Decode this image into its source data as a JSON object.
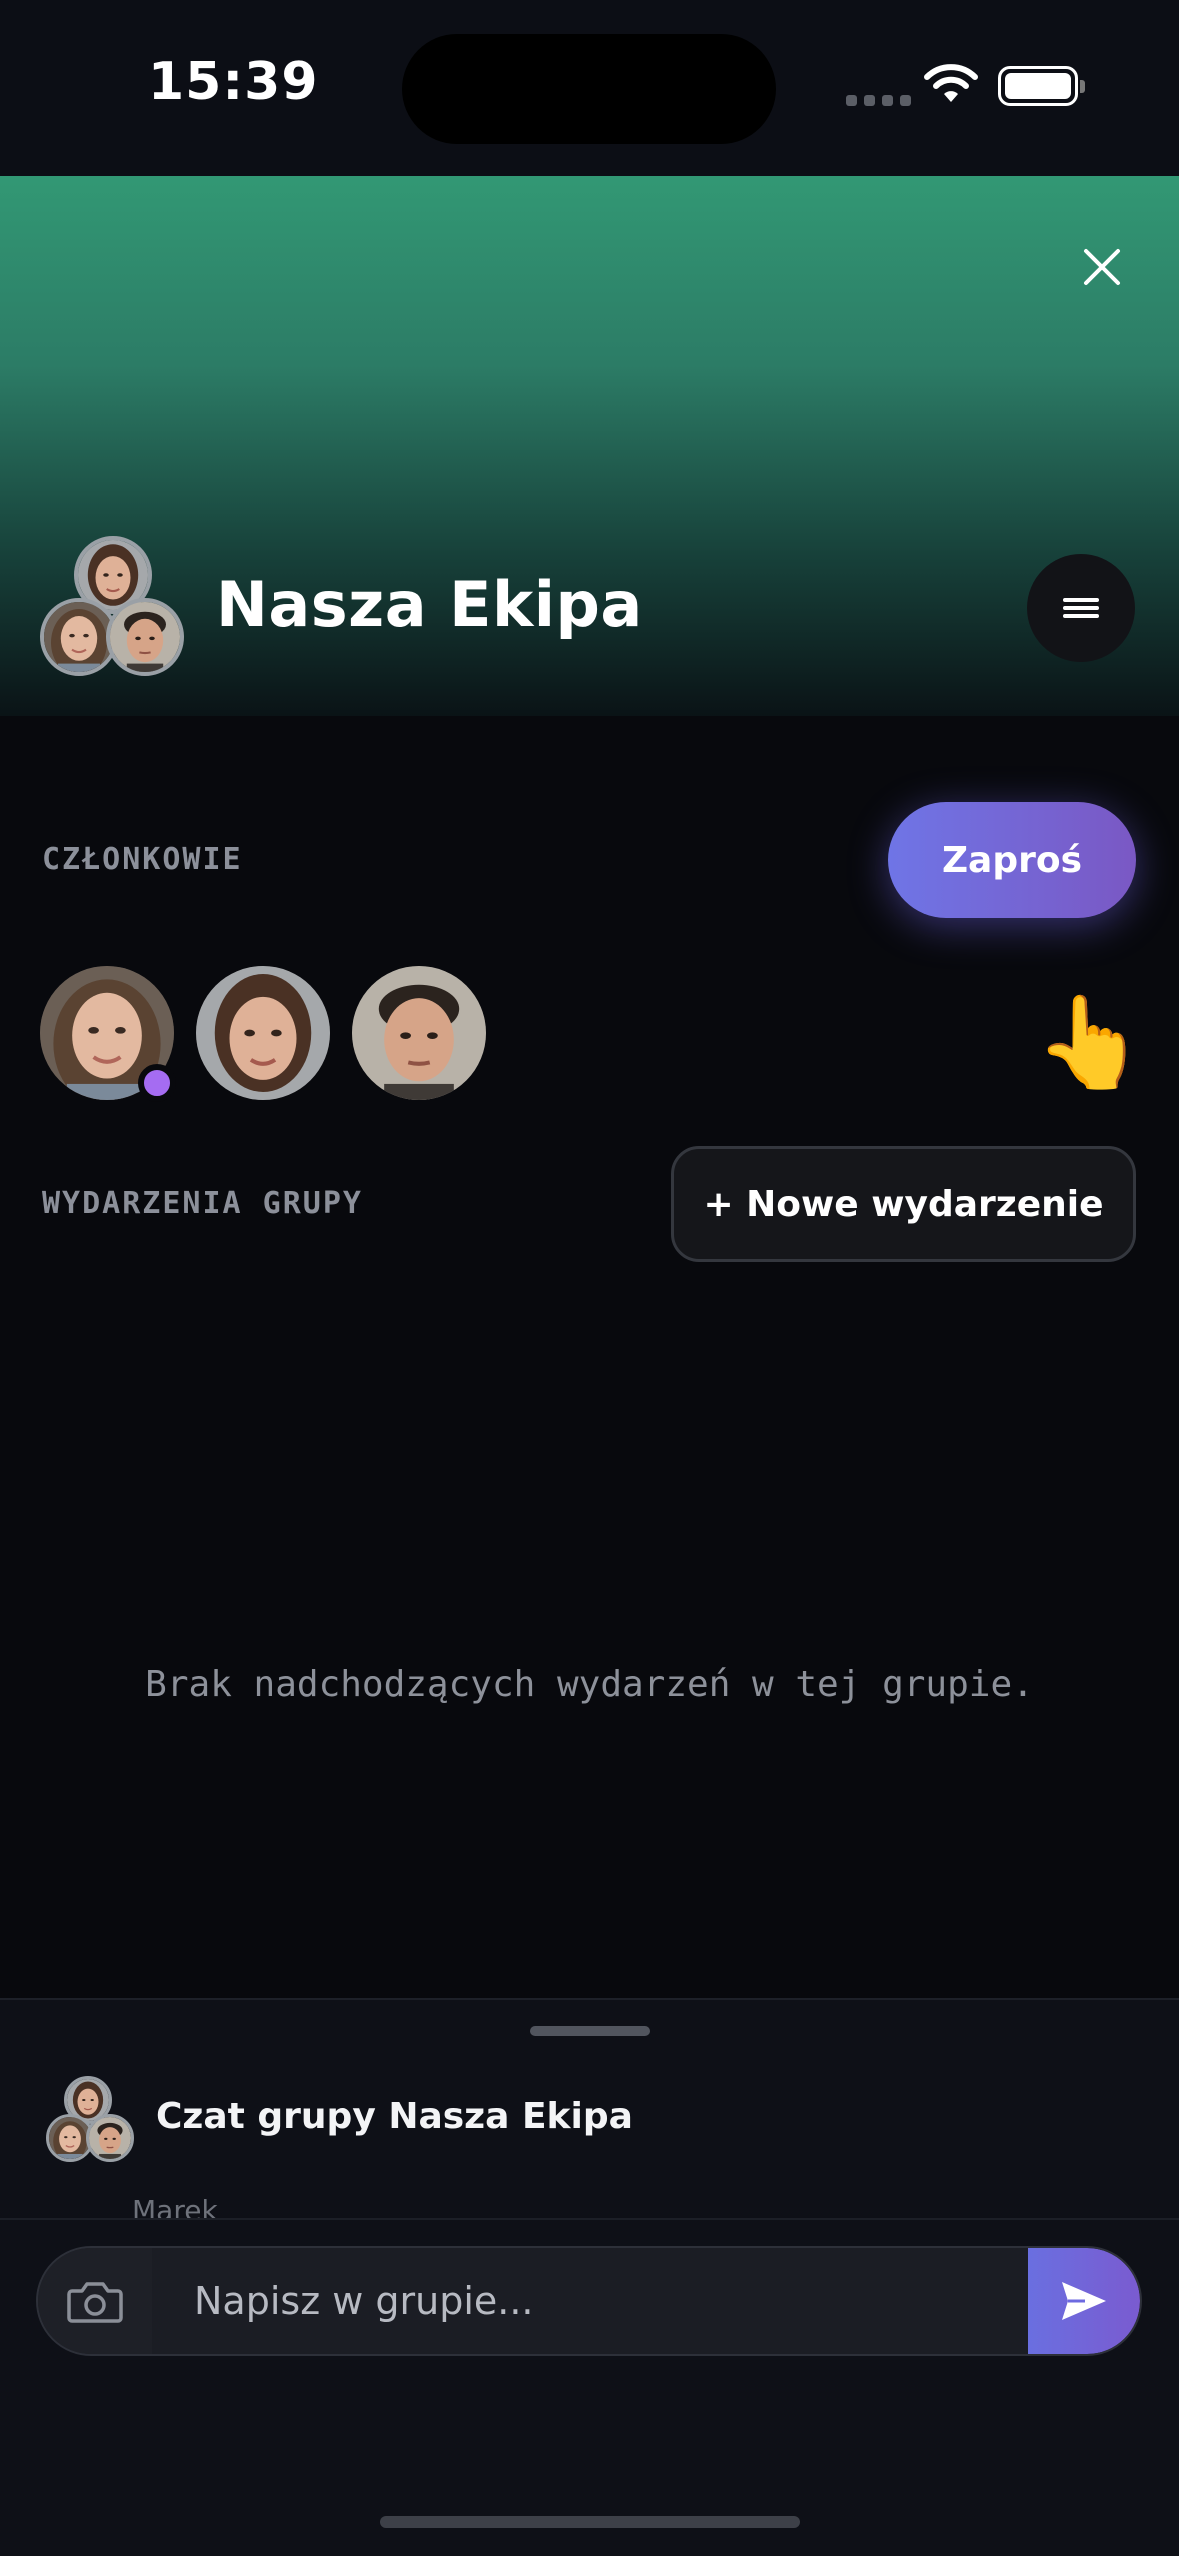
{
  "status_bar": {
    "time": "15:39"
  },
  "group": {
    "name": "Nasza Ekipa"
  },
  "members_section": {
    "label": "CZŁONKOWIE",
    "invite_label": "Zaproś"
  },
  "events_section": {
    "label": "WYDARZENIA GRUPY",
    "new_event_label": "+ Nowe wydarzenie",
    "empty_message": "Brak nadchodzących wydarzeń w tej grupie."
  },
  "chat": {
    "title": "Czat grupy Nasza Ekipa",
    "last_sender": "Marek",
    "input_placeholder": "Napisz w grupie..."
  },
  "icons": {
    "close": "close-icon",
    "menu": "hamburger-menu-icon",
    "camera": "camera-icon",
    "send": "send-icon",
    "pointer": "pointing-hand-emoji"
  },
  "colors": {
    "hero_top": "#329874",
    "accent_purple": "#7a58c4",
    "online_dot": "#a56cf2",
    "background": "#08090d"
  }
}
